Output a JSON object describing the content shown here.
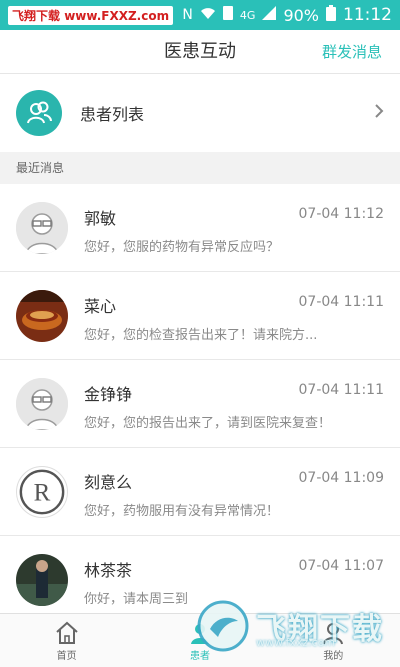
{
  "status_bar": {
    "watermark_prefix": "飞翔下载",
    "watermark_url": "www.FXXZ.com",
    "network": "4G",
    "battery": "90%",
    "time": "11:12"
  },
  "header": {
    "title": "医患互动",
    "action_label": "群发消息"
  },
  "patient_list": {
    "label": "患者列表"
  },
  "section": {
    "recent_label": "最近消息"
  },
  "messages": [
    {
      "name": "郭敏",
      "time": "07-04 11:12",
      "preview": "您好，您服的药物有异常反应吗？",
      "avatar": "person-glasses"
    },
    {
      "name": "菜心",
      "time": "07-04 11:11",
      "preview": "您好，您的检查报告出来了！请来院方...",
      "avatar": "teacup-photo"
    },
    {
      "name": "金铮铮",
      "time": "07-04 11:11",
      "preview": "您好，您的报告出来了，请到医院来复查！",
      "avatar": "person-glasses"
    },
    {
      "name": "刻意么",
      "time": "07-04 11:09",
      "preview": "您好，药物服用有没有异常情况！",
      "avatar": "registered-logo"
    },
    {
      "name": "林茶茶",
      "time": "07-04 11:07",
      "preview": "你好，请本周三到",
      "avatar": "photo"
    }
  ],
  "tabbar": {
    "tabs": [
      {
        "label": "首页",
        "icon": "home-icon"
      },
      {
        "label": "患者",
        "icon": "patients-icon"
      },
      {
        "label": "我的",
        "icon": "profile-icon"
      }
    ]
  },
  "watermark": {
    "big": "飞翔下载",
    "small": "www.fxxz.com"
  },
  "colors": {
    "accent": "#2ac0b8",
    "status_bar": "#2ac0b8",
    "section_bg": "#f2f2f2"
  }
}
